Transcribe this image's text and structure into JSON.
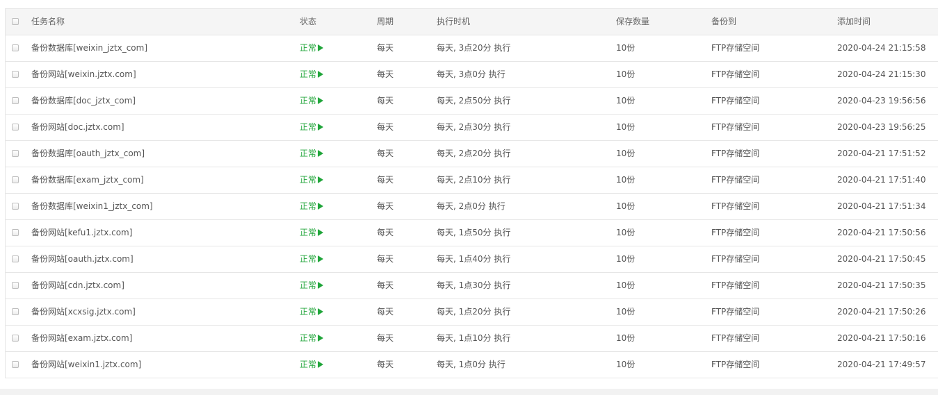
{
  "table": {
    "columns": {
      "name": "任务名称",
      "status": "状态",
      "period": "周期",
      "exec_time": "执行时机",
      "keep": "保存数量",
      "backup_to": "备份到",
      "added": "添加时间"
    },
    "rows": [
      {
        "name": "备份数据库[weixin_jztx_com]",
        "status": "正常",
        "period": "每天",
        "exec_time": "每天, 3点20分 执行",
        "keep": "10份",
        "backup_to": "FTP存储空间",
        "added": "2020-04-24 21:15:58"
      },
      {
        "name": "备份网站[weixin.jztx.com]",
        "status": "正常",
        "period": "每天",
        "exec_time": "每天, 3点0分 执行",
        "keep": "10份",
        "backup_to": "FTP存储空间",
        "added": "2020-04-24 21:15:30"
      },
      {
        "name": "备份数据库[doc_jztx_com]",
        "status": "正常",
        "period": "每天",
        "exec_time": "每天, 2点50分 执行",
        "keep": "10份",
        "backup_to": "FTP存储空间",
        "added": "2020-04-23 19:56:56"
      },
      {
        "name": "备份网站[doc.jztx.com]",
        "status": "正常",
        "period": "每天",
        "exec_time": "每天, 2点30分 执行",
        "keep": "10份",
        "backup_to": "FTP存储空间",
        "added": "2020-04-23 19:56:25"
      },
      {
        "name": "备份数据库[oauth_jztx_com]",
        "status": "正常",
        "period": "每天",
        "exec_time": "每天, 2点20分 执行",
        "keep": "10份",
        "backup_to": "FTP存储空间",
        "added": "2020-04-21 17:51:52"
      },
      {
        "name": "备份数据库[exam_jztx_com]",
        "status": "正常",
        "period": "每天",
        "exec_time": "每天, 2点10分 执行",
        "keep": "10份",
        "backup_to": "FTP存储空间",
        "added": "2020-04-21 17:51:40"
      },
      {
        "name": "备份数据库[weixin1_jztx_com]",
        "status": "正常",
        "period": "每天",
        "exec_time": "每天, 2点0分 执行",
        "keep": "10份",
        "backup_to": "FTP存储空间",
        "added": "2020-04-21 17:51:34"
      },
      {
        "name": "备份网站[kefu1.jztx.com]",
        "status": "正常",
        "period": "每天",
        "exec_time": "每天, 1点50分 执行",
        "keep": "10份",
        "backup_to": "FTP存储空间",
        "added": "2020-04-21 17:50:56"
      },
      {
        "name": "备份网站[oauth.jztx.com]",
        "status": "正常",
        "period": "每天",
        "exec_time": "每天, 1点40分 执行",
        "keep": "10份",
        "backup_to": "FTP存储空间",
        "added": "2020-04-21 17:50:45"
      },
      {
        "name": "备份网站[cdn.jztx.com]",
        "status": "正常",
        "period": "每天",
        "exec_time": "每天, 1点30分 执行",
        "keep": "10份",
        "backup_to": "FTP存储空间",
        "added": "2020-04-21 17:50:35"
      },
      {
        "name": "备份网站[xcxsig.jztx.com]",
        "status": "正常",
        "period": "每天",
        "exec_time": "每天, 1点20分 执行",
        "keep": "10份",
        "backup_to": "FTP存储空间",
        "added": "2020-04-21 17:50:26"
      },
      {
        "name": "备份网站[exam.jztx.com]",
        "status": "正常",
        "period": "每天",
        "exec_time": "每天, 1点10分 执行",
        "keep": "10份",
        "backup_to": "FTP存储空间",
        "added": "2020-04-21 17:50:16"
      },
      {
        "name": "备份网站[weixin1.jztx.com]",
        "status": "正常",
        "period": "每天",
        "exec_time": "每天, 1点0分 执行",
        "keep": "10份",
        "backup_to": "FTP存储空间",
        "added": "2020-04-21 17:49:57"
      }
    ]
  },
  "icons": {
    "status_icon": "play-icon"
  },
  "colors": {
    "status_ok": "#20a53a",
    "header_bg": "#f5f5f5",
    "border": "#e6e6e6"
  }
}
